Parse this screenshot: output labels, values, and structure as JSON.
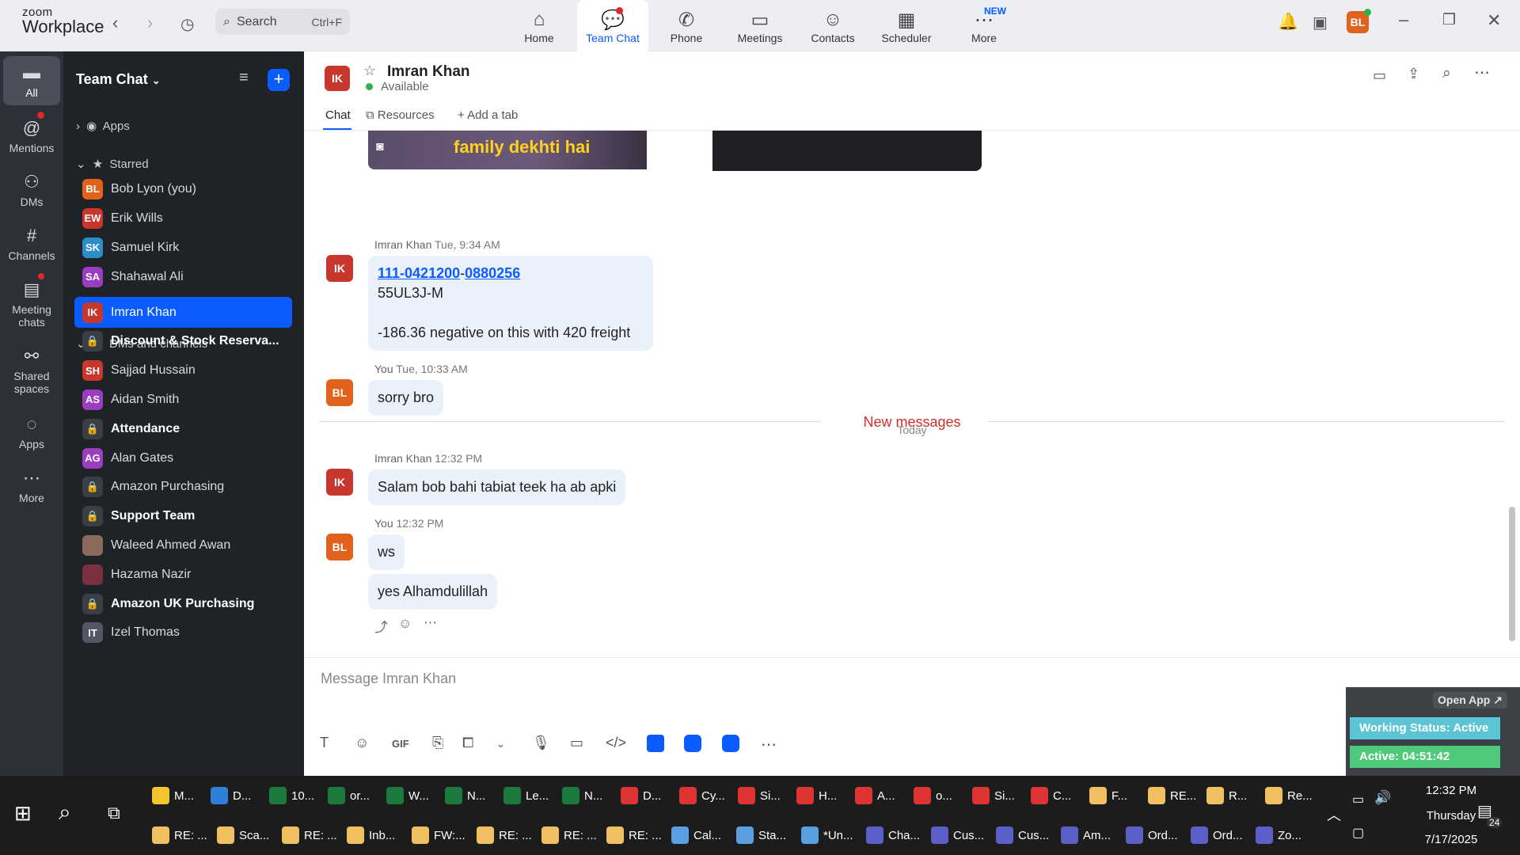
{
  "app": {
    "brand_top": "zoom",
    "brand_bottom": "Workplace"
  },
  "search": {
    "placeholder": "Search",
    "shortcut": "Ctrl+F"
  },
  "nav": {
    "home": "Home",
    "team_chat": "Team Chat",
    "phone": "Phone",
    "meetings": "Meetings",
    "contacts": "Contacts",
    "scheduler": "Scheduler",
    "more": "More",
    "new_badge": "NEW"
  },
  "user": {
    "initials": "BL"
  },
  "rail": {
    "all": "All",
    "mentions": "Mentions",
    "dms": "DMs",
    "channels": "Channels",
    "meeting_chats": "Meeting chats",
    "shared_spaces": "Shared spaces",
    "apps": "Apps",
    "more": "More"
  },
  "sidebar": {
    "title": "Team Chat",
    "apps": "Apps",
    "starred": "Starred",
    "starred_items": [
      {
        "initials": "BL",
        "name": "Bob Lyon (you)",
        "color": "#e0621c"
      },
      {
        "initials": "EW",
        "name": "Erik Wills",
        "color": "#c8372d"
      },
      {
        "initials": "SK",
        "name": "Samuel Kirk",
        "color": "#2d8dc8"
      },
      {
        "initials": "SA",
        "name": "Shahawal Ali",
        "color": "#9b3dbf"
      }
    ],
    "dms_section": "DMs and channels",
    "items": [
      {
        "initials": "IK",
        "name": "Imran Khan",
        "color": "#c8372d",
        "type": "dm"
      },
      {
        "initials": "",
        "name": "Discount & Stock Reserva...",
        "type": "channel",
        "bold": true
      },
      {
        "initials": "SH",
        "name": "Sajjad Hussain",
        "color": "#c8372d",
        "type": "dm"
      },
      {
        "initials": "AS",
        "name": "Aidan Smith",
        "color": "#9b3dbf",
        "type": "dm"
      },
      {
        "initials": "",
        "name": "Attendance",
        "type": "channel",
        "bold": true
      },
      {
        "initials": "AG",
        "name": "Alan Gates",
        "color": "#9b3dbf",
        "type": "dm"
      },
      {
        "initials": "",
        "name": "Amazon Purchasing",
        "type": "channel"
      },
      {
        "initials": "",
        "name": "Support Team",
        "type": "channel",
        "bold": true
      },
      {
        "initials": "",
        "name": "Waleed Ahmed Awan",
        "color": "#8a6a5a",
        "type": "dm"
      },
      {
        "initials": "",
        "name": "Hazama Nazir",
        "color": "#7a3040",
        "type": "dm"
      },
      {
        "initials": "",
        "name": "Amazon UK Purchasing",
        "type": "channel",
        "bold": true
      },
      {
        "initials": "IT",
        "name": "Izel Thomas",
        "color": "#556",
        "type": "dm"
      }
    ]
  },
  "chat": {
    "contact_initials": "IK",
    "contact_name": "Imran Khan",
    "status": "Available",
    "tabs": {
      "chat": "Chat",
      "resources": "Resources",
      "add": "Add a tab"
    },
    "image_caption": "family dekhti hai",
    "msg1": {
      "sender": "Imran Khan",
      "time": "Tue, 9:34 AM",
      "link1": "111-0421200",
      "dash": "-",
      "link2": "0880256",
      "line2": "55UL3J-M",
      "line3": "-186.36 negative  on this  with 420 freight"
    },
    "msg2": {
      "sender": "You",
      "time": "Tue, 10:33 AM",
      "text": "sorry bro"
    },
    "today": "Today",
    "new_messages": "New messages",
    "msg3": {
      "sender": "Imran Khan",
      "time": "12:32 PM",
      "text": "Salam bob bahi  tabiat teek ha ab apki"
    },
    "msg4": {
      "sender": "You",
      "time": "12:32 PM",
      "text1": "ws",
      "text2": "yes Alhamdulillah"
    },
    "composer_placeholder": "Message Imran Khan",
    "gif": "GIF"
  },
  "widget": {
    "open_app": "Open App ↗",
    "working_status": "Working Status: Active",
    "active_timer": "Active: 04:51:42"
  },
  "taskbar": {
    "row1": [
      "M...",
      "D...",
      "10...",
      "or...",
      "W...",
      "N...",
      "Le...",
      "N...",
      "D...",
      "Cy...",
      "Si...",
      "H...",
      "A...",
      "o...",
      "Si...",
      "C...",
      "F...",
      "RE...",
      "R...",
      "Re..."
    ],
    "row2": [
      "RE: ...",
      "Sca...",
      "RE: ...",
      "Inb...",
      "FW:...",
      "RE: ...",
      "RE: ...",
      "RE: ...",
      "Cal...",
      "Sta...",
      "*Un...",
      "Cha...",
      "Cus...",
      "Cus...",
      "Am...",
      "Ord...",
      "Ord...",
      "Zo..."
    ],
    "time": "12:32 PM",
    "day": "Thursday",
    "date": "7/17/2025",
    "notif": "24"
  }
}
